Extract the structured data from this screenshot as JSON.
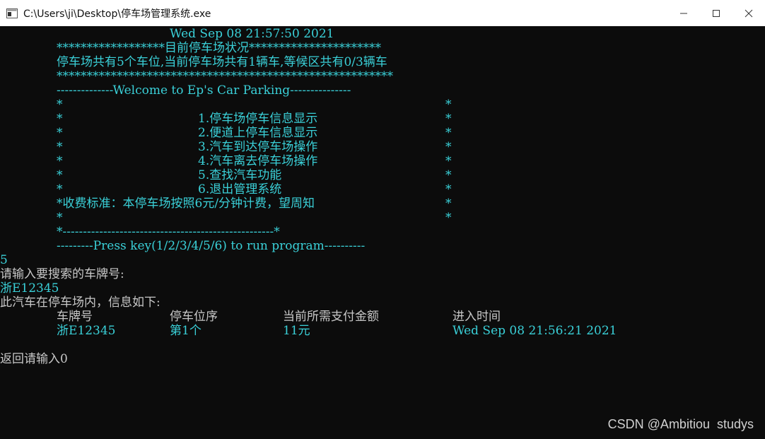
{
  "window": {
    "title": "C:\\Users\\ji\\Desktop\\停车场管理系统.exe",
    "icon": "console-app-icon",
    "controls": [
      "minimize-icon",
      "maximize-icon",
      "close-icon"
    ]
  },
  "console": {
    "header": {
      "datetime": "Wed Sep 08 21:57:50 2021",
      "status_banner": "******************目前停车场状况**********************",
      "status_line": "停车场共有5个车位,当前停车场共有1辆车,等候区共有0/3辆车",
      "stars_line": "********************************************************",
      "welcome_line": "--------------Welcome to Ep's Car Parking---------------"
    },
    "menu": {
      "border_char": "*",
      "items": [
        "1.停车场停车信息显示",
        "2.便道上停车信息显示",
        "3.汽车到达停车场操作",
        "4.汽车离去停车场操作",
        "5.查找汽车功能",
        "6.退出管理系统"
      ],
      "fee_note": "*收费标准：本停车场按照6元/分钟计费，望周知",
      "bottom_border": "*----------------------------------------------------*",
      "press_key_line": "---------Press key(1/2/3/4/5/6) to run program----------"
    },
    "session": {
      "user_choice": "5",
      "prompt_plate": "请输入要搜索的车牌号:",
      "input_plate": "浙E12345",
      "result_intro": "此汽车在停车场内，信息如下:",
      "table": {
        "headers": [
          "车牌号",
          "停车位序",
          "当前所需支付金额",
          "进入时间"
        ],
        "rows": [
          [
            "浙E12345",
            "第1个",
            "11元",
            "Wed Sep 08 21:56:21 2021"
          ]
        ]
      },
      "return_prompt": "返回请输入0"
    }
  },
  "watermark": "CSDN @Ambitiou  studys"
}
